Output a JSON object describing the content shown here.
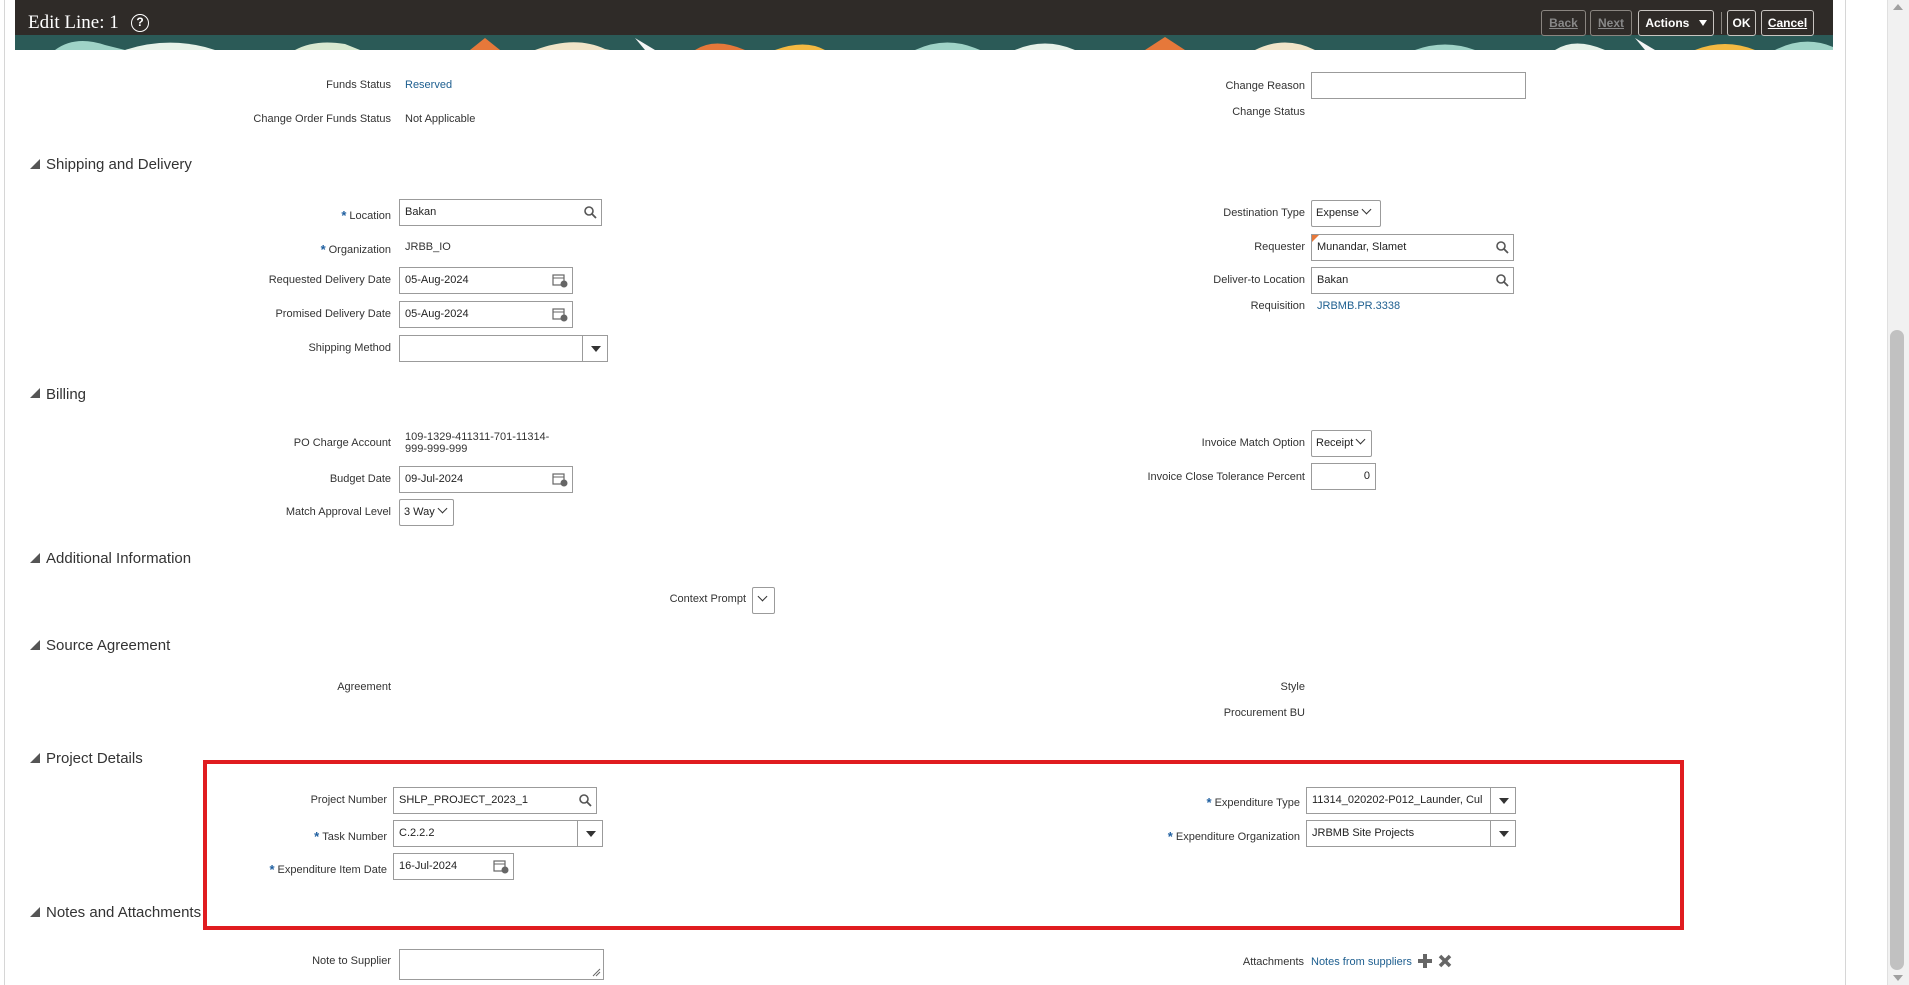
{
  "header": {
    "title": "Edit Line: 1",
    "help_glyph": "?",
    "back_label": "Back",
    "next_label": "Next",
    "actions_label": "Actions",
    "ok_label": "OK",
    "cancel_label": "Cancel"
  },
  "funds": {
    "funds_status_label": "Funds Status",
    "funds_status_value": "Reserved",
    "change_order_funds_status_label": "Change Order Funds Status",
    "change_order_funds_status_value": "Not Applicable",
    "change_reason_label": "Change Reason",
    "change_reason_value": "",
    "change_status_label": "Change Status"
  },
  "shipping": {
    "title": "Shipping and Delivery",
    "location_label": "Location",
    "location_value": "Bakan",
    "organization_label": "Organization",
    "organization_value": "JRBB_IO",
    "requested_delivery_date_label": "Requested Delivery Date",
    "requested_delivery_date_value": "05-Aug-2024",
    "promised_delivery_date_label": "Promised Delivery Date",
    "promised_delivery_date_value": "05-Aug-2024",
    "shipping_method_label": "Shipping Method",
    "shipping_method_value": "",
    "destination_type_label": "Destination Type",
    "destination_type_value": "Expense",
    "requester_label": "Requester",
    "requester_value": "Munandar, Slamet",
    "deliver_to_location_label": "Deliver-to Location",
    "deliver_to_location_value": "Bakan",
    "requisition_label": "Requisition",
    "requisition_value": "JRBMB.PR.3338"
  },
  "billing": {
    "title": "Billing",
    "po_charge_account_label": "PO Charge Account",
    "po_charge_account_line1": "109-1329-411311-701-11314-",
    "po_charge_account_line2": "999-999-999",
    "budget_date_label": "Budget Date",
    "budget_date_value": "09-Jul-2024",
    "match_approval_level_label": "Match Approval Level",
    "match_approval_level_value": "3 Way",
    "invoice_match_option_label": "Invoice Match Option",
    "invoice_match_option_value": "Receipt",
    "invoice_close_tolerance_label": "Invoice Close Tolerance Percent",
    "invoice_close_tolerance_value": "0"
  },
  "additional": {
    "title": "Additional Information",
    "context_prompt_label": "Context Prompt"
  },
  "source_agreement": {
    "title": "Source Agreement",
    "agreement_label": "Agreement",
    "style_label": "Style",
    "procurement_bu_label": "Procurement BU"
  },
  "project": {
    "title": "Project Details",
    "project_number_label": "Project Number",
    "project_number_value": "SHLP_PROJECT_2023_1",
    "task_number_label": "Task Number",
    "task_number_value": "C.2.2.2",
    "expenditure_item_date_label": "Expenditure Item Date",
    "expenditure_item_date_value": "16-Jul-2024",
    "expenditure_type_label": "Expenditure Type",
    "expenditure_type_value": "11314_020202-P012_Launder, Cul",
    "expenditure_organization_label": "Expenditure Organization",
    "expenditure_organization_value": "JRBMB Site Projects"
  },
  "notes": {
    "title": "Notes and Attachments",
    "note_to_supplier_label": "Note to Supplier",
    "note_to_supplier_value": "",
    "attachments_label": "Attachments",
    "attachments_link": "Notes from suppliers"
  },
  "required_marker": "*",
  "colors": {
    "header_bg": "#2f2b28",
    "link": "#1d5e8f",
    "required": "#1f5fa0",
    "highlight_box": "#e01c20"
  }
}
